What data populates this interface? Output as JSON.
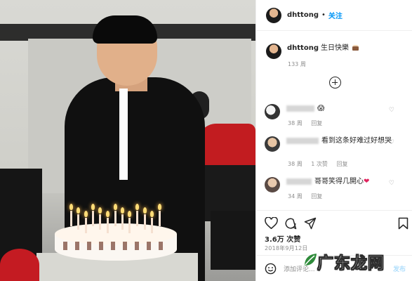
{
  "post": {
    "username": "dhttong",
    "separator": "•",
    "follow_label": "关注",
    "caption_text": "生日快樂",
    "caption_time": "133 周",
    "likes_label": "3.6万 次赞",
    "date": "2018年9月12日"
  },
  "comments": [
    {
      "text": "",
      "emoji": "😱",
      "time": "38 周",
      "reply_label": "回复",
      "likes": ""
    },
    {
      "text": "看到这条好难过好想哭",
      "emoji": "",
      "time": "38 周",
      "reply_label": "回复",
      "likes": "1 次赞"
    },
    {
      "text": "哥哥笑得几開心",
      "emoji": "❤",
      "time": "34 周",
      "reply_label": "回复",
      "likes": ""
    }
  ],
  "composer": {
    "placeholder": "添加评论...",
    "post_label": "发布"
  },
  "watermark": {
    "text": "广东龙网"
  },
  "colors": {
    "follow_blue": "#0095f6",
    "post_disabled": "#b2dffc",
    "meta_grey": "#8e8e8e",
    "heart_red": "#e0245e",
    "watermark_green": "#2e8b3a"
  },
  "icons": [
    "heart-icon",
    "comment-icon",
    "share-icon",
    "bookmark-icon",
    "emoji-icon",
    "add-icon",
    "more-icon"
  ]
}
